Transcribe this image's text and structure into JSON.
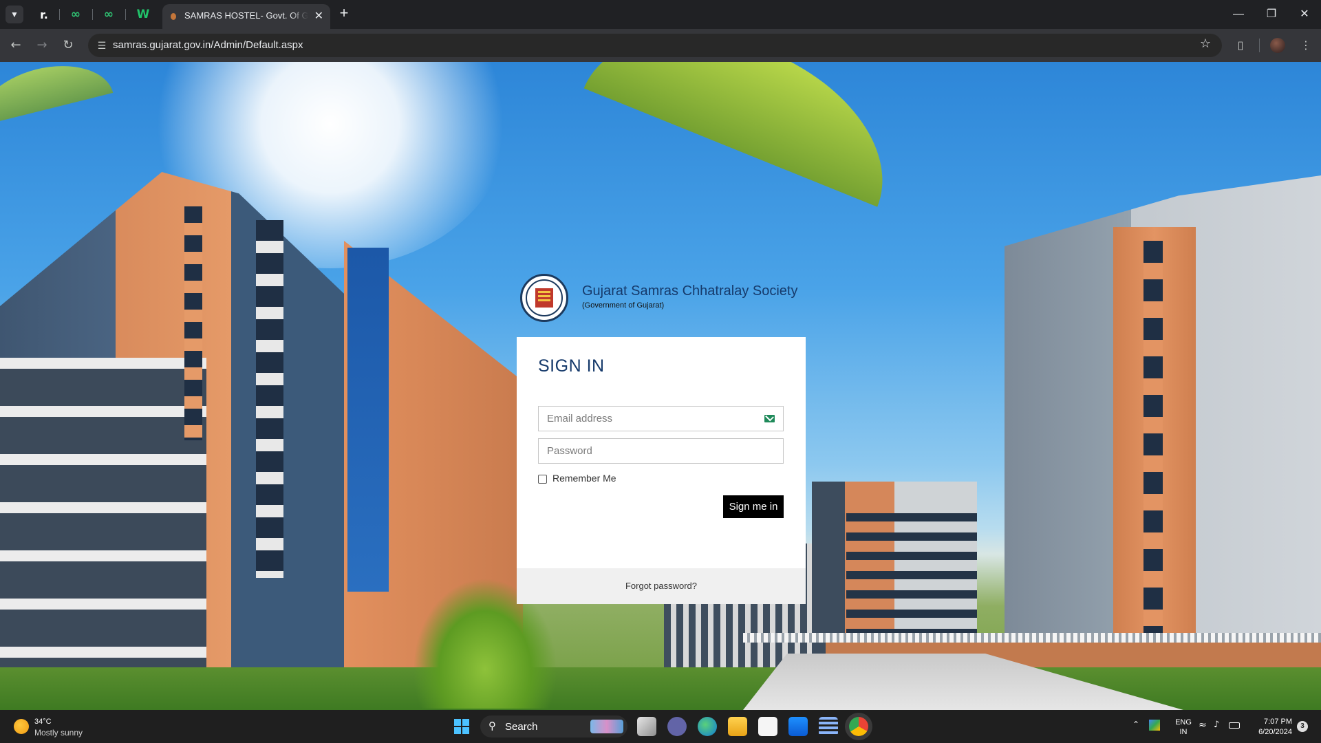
{
  "browser": {
    "pinned_tabs": [
      {
        "icon": "r-logo-icon",
        "glyph": "r."
      },
      {
        "icon": "green-oo-icon",
        "glyph": "∞"
      },
      {
        "icon": "green-oo-icon",
        "glyph": "∞"
      },
      {
        "icon": "green-w-icon",
        "glyph": "W"
      }
    ],
    "active_tab_title": "SAMRAS HOSTEL- Govt. Of Gujarat",
    "url": "samras.gujarat.gov.in/Admin/Default.aspx",
    "new_tab_glyph": "+",
    "close_glyph": "✕",
    "window_controls": {
      "minimize": "—",
      "restore": "❐",
      "close": "✕"
    }
  },
  "brand": {
    "name": "Gujarat Samras Chhatralay Society",
    "subtitle": "(Government of Gujarat)"
  },
  "login": {
    "heading": "SIGN IN",
    "email_placeholder": "Email address",
    "password_placeholder": "Password",
    "remember_label": "Remember Me",
    "submit_label": "Sign me in",
    "forgot_label": "Forgot password?"
  },
  "taskbar": {
    "weather_temp": "34°C",
    "weather_desc": "Mostly sunny",
    "search_label": "Search",
    "lang_line1": "ENG",
    "lang_line2": "IN",
    "time": "7:07 PM",
    "date": "6/20/2024",
    "notification_count": "3"
  },
  "colors": {
    "heading_blue": "#163a6b",
    "button_black": "#000000",
    "mail_icon_green": "#1f8a5a"
  }
}
